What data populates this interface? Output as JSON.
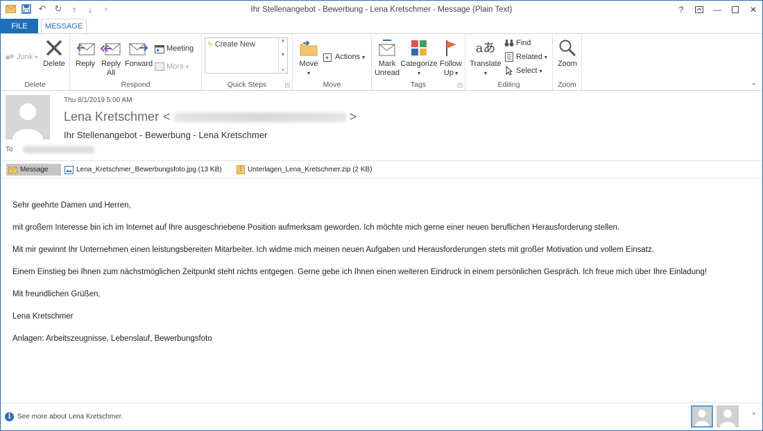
{
  "window": {
    "title": "Ihr Stellenangebot - Bewerbung - Lena Kretschmer - Message (Plain Text)",
    "help": "?",
    "controls": [
      "ribbon-display-options",
      "minimize",
      "maximize",
      "close"
    ]
  },
  "tabs": {
    "file": "FILE",
    "message": "MESSAGE"
  },
  "ribbon": {
    "delete": {
      "junk": "Junk",
      "delete": "Delete",
      "label": "Delete"
    },
    "respond": {
      "reply": "Reply",
      "reply_all_1": "Reply",
      "reply_all_2": "All",
      "forward": "Forward",
      "meeting": "Meeting",
      "more": "More",
      "label": "Respond"
    },
    "quicksteps": {
      "create_new": "Create New",
      "label": "Quick Steps"
    },
    "move": {
      "move": "Move",
      "actions": "Actions",
      "label": "Move"
    },
    "tags": {
      "mark_1": "Mark",
      "mark_2": "Unread",
      "categorize": "Categorize",
      "follow_1": "Follow",
      "follow_2": "Up",
      "label": "Tags"
    },
    "editing": {
      "translate": "Translate",
      "find": "Find",
      "related": "Related",
      "select": "Select",
      "label": "Editing"
    },
    "zoom": {
      "zoom": "Zoom",
      "label": "Zoom"
    }
  },
  "header": {
    "date": "Thu 8/1/2019 5:00 AM",
    "from_name": "Lena Kretschmer",
    "subject": "Ihr Stellenangebot - Bewerbung - Lena Kretschmer",
    "to_label": "To"
  },
  "attachments": [
    {
      "name": "Message"
    },
    {
      "name": "Lena_Kretschmer_Bewerbungsfoto.jpg (13 KB)"
    },
    {
      "name": "Unterlagen_Lena_Kretschmer.zip (2 KB)"
    }
  ],
  "body": [
    "Sehr geehrte Damen und Herren,",
    "mit großem Interesse bin ich im Internet auf Ihre ausgeschriebene Position aufmerksam geworden. Ich möchte mich gerne einer neuen beruflichen Herausforderung stellen.",
    "Mit mir gewinnt Ihr Unternehmen einen leistungsbereiten Mitarbeiter. Ich widme mich meinen neuen Aufgaben und Herausforderungen stets mit großer Motivation und vollem Einsatz.",
    "Einem Einstieg bei Ihnen zum nächstmöglichen Zeitpunkt steht nichts entgegen. Gerne gebe ich Ihnen einen weiteren Eindruck in einem persönlichen Gespräch. Ich freue mich über Ihre Einladung!",
    "Mit freundlichen Grüßen,",
    "Lena Kretschmer",
    "Anlagen: Arbeitszeugnisse, Lebenslauf, Bewerbungsfoto"
  ],
  "footer": {
    "see_more": "See more about Lena Kretschmer."
  }
}
